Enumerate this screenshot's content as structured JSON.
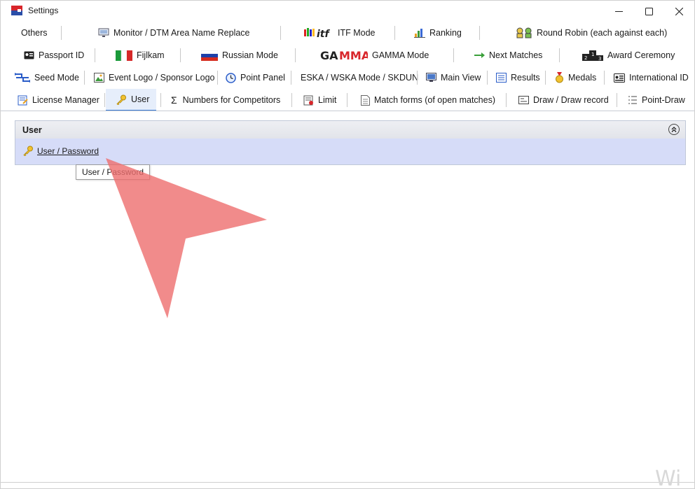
{
  "window": {
    "title": "Settings"
  },
  "tabs": {
    "row1": [
      {
        "label": "Others",
        "icon": "none"
      },
      {
        "label": "Monitor / DTM Area Name Replace",
        "icon": "monitor-icon"
      },
      {
        "label": "ITF Mode",
        "icon": "itf-logo-icon"
      },
      {
        "label": "Ranking",
        "icon": "bar-chart-icon"
      },
      {
        "label": "Round Robin (each against each)",
        "icon": "round-robin-icon"
      }
    ],
    "row2": [
      {
        "label": "Passport ID",
        "icon": "id-card-icon"
      },
      {
        "label": "Fijlkam",
        "icon": "italy-flag-icon"
      },
      {
        "label": "Russian Mode",
        "icon": "russia-flag-icon"
      },
      {
        "label": "GAMMA Mode",
        "icon": "gamma-logo-icon"
      },
      {
        "label": "Next Matches",
        "icon": "arrow-right-icon"
      },
      {
        "label": "Award Ceremony",
        "icon": "podium-icon"
      }
    ],
    "row3": [
      {
        "label": "Seed Mode",
        "icon": "seed-arrows-icon"
      },
      {
        "label": "Event Logo / Sponsor Logo",
        "icon": "image-icon"
      },
      {
        "label": "Point Panel",
        "icon": "clock-icon"
      },
      {
        "label": "ESKA / WSKA Mode / SKDUN",
        "icon": "none"
      },
      {
        "label": "Main View",
        "icon": "main-view-icon"
      },
      {
        "label": "Results",
        "icon": "list-icon"
      },
      {
        "label": "Medals",
        "icon": "medal-icon"
      },
      {
        "label": "International ID",
        "icon": "international-id-icon"
      }
    ],
    "row4": [
      {
        "label": "License Manager",
        "icon": "license-icon"
      },
      {
        "label": "User",
        "icon": "key-icon",
        "active": true
      },
      {
        "label": "Numbers for Competitors",
        "icon": "sigma-icon"
      },
      {
        "label": "Limit",
        "icon": "limit-icon"
      },
      {
        "label": "Match forms (of open matches)",
        "icon": "document-icon"
      },
      {
        "label": "Draw / Draw record",
        "icon": "draw-icon"
      },
      {
        "label": "Point-Draw",
        "icon": "point-draw-icon"
      }
    ]
  },
  "panel": {
    "title": "User",
    "items": [
      {
        "label": "User / Password",
        "icon": "key-icon"
      }
    ]
  },
  "tooltip": {
    "text": "User / Password"
  },
  "watermark": {
    "text": "Wi"
  },
  "colors": {
    "accent": "#3a7bd5",
    "panel_body": "#d6dcf8",
    "arrow": "#ee6e6e"
  }
}
